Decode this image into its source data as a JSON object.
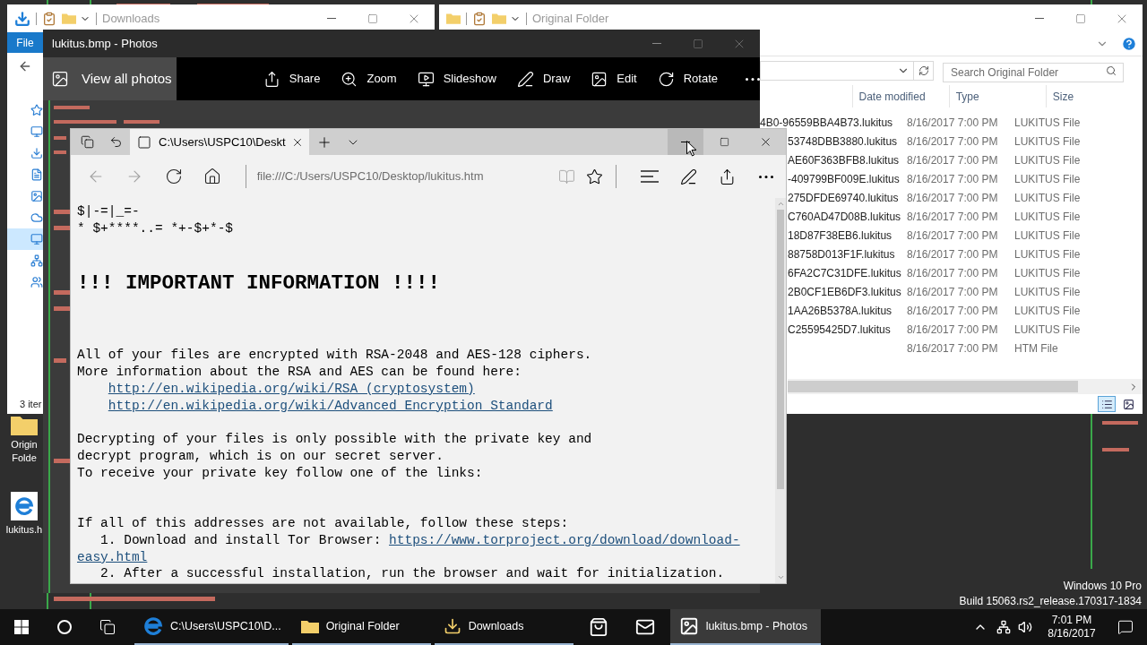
{
  "desktop": {
    "icons": [
      {
        "kind": "folder",
        "label": "Origin Folde"
      },
      {
        "kind": "browser",
        "label": "lukitus.h"
      }
    ],
    "watermark": [
      "Windows 10 Pro",
      "Build 15063.rs2_release.170317-1834"
    ]
  },
  "downloads_window": {
    "title": "Downloads",
    "ribbon_tab": "File",
    "status": "3 iter",
    "nav_items": [
      {
        "kind": "quick-access",
        "selected": false
      },
      {
        "kind": "desktop",
        "selected": false
      },
      {
        "kind": "downloads",
        "selected": false
      },
      {
        "kind": "documents",
        "selected": false
      },
      {
        "kind": "pictures",
        "selected": false
      },
      {
        "kind": "cloud",
        "selected": false
      },
      {
        "kind": "pc",
        "selected": true
      },
      {
        "kind": "network",
        "selected": false
      },
      {
        "kind": "homegroup",
        "selected": false
      }
    ]
  },
  "original_folder_window": {
    "title": "Original Folder",
    "search": {
      "placeholder": "Search Original Folder"
    },
    "columns": [
      "Date modified",
      "Type",
      "Size"
    ],
    "rows": [
      {
        "name": "4B0-96559BBA4B73.lukitus",
        "date": "8/16/2017 7:00 PM",
        "type": "LUKITUS File"
      },
      {
        "name": "53748DBB3880.lukitus",
        "date": "8/16/2017 7:00 PM",
        "type": "LUKITUS File"
      },
      {
        "name": "AE60F363BFB8.lukitus",
        "date": "8/16/2017 7:00 PM",
        "type": "LUKITUS File"
      },
      {
        "name": "-409799BF009E.lukitus",
        "date": "8/16/2017 7:00 PM",
        "type": "LUKITUS File"
      },
      {
        "name": "275DFDE69740.lukitus",
        "date": "8/16/2017 7:00 PM",
        "type": "LUKITUS File"
      },
      {
        "name": "C760AD47D08B.lukitus",
        "date": "8/16/2017 7:00 PM",
        "type": "LUKITUS File"
      },
      {
        "name": "18D87F38EB6.lukitus",
        "date": "8/16/2017 7:00 PM",
        "type": "LUKITUS File"
      },
      {
        "name": "88758D013F1F.lukitus",
        "date": "8/16/2017 7:00 PM",
        "type": "LUKITUS File"
      },
      {
        "name": "6FA2C7C31DFE.lukitus",
        "date": "8/16/2017 7:00 PM",
        "type": "LUKITUS File"
      },
      {
        "name": "2B0CF1EB6DF3.lukitus",
        "date": "8/16/2017 7:00 PM",
        "type": "LUKITUS File"
      },
      {
        "name": "1AA26B5378A.lukitus",
        "date": "8/16/2017 7:00 PM",
        "type": "LUKITUS File"
      },
      {
        "name": "C25595425D7.lukitus",
        "date": "8/16/2017 7:00 PM",
        "type": "LUKITUS File"
      },
      {
        "date": "8/16/2017 7:00 PM",
        "type": "HTM File"
      }
    ]
  },
  "photos_window": {
    "title": "lukitus.bmp - Photos",
    "view_all": "View all photos",
    "tools": [
      {
        "kind": "share",
        "label": "Share"
      },
      {
        "kind": "zoom",
        "label": "Zoom"
      },
      {
        "kind": "slideshow",
        "label": "Slideshow"
      },
      {
        "kind": "draw",
        "label": "Draw"
      },
      {
        "kind": "edit",
        "label": "Edit"
      },
      {
        "kind": "rotate",
        "label": "Rotate"
      },
      {
        "kind": "more"
      }
    ]
  },
  "browser": {
    "tab": {
      "title": "C:\\Users\\USPC10\\Deskt"
    },
    "minimize_hovered": true,
    "nav_buttons": [
      {
        "kind": "back",
        "disabled": true
      },
      {
        "kind": "forward",
        "disabled": true
      },
      {
        "kind": "refresh",
        "disabled": false
      },
      {
        "kind": "home",
        "disabled": false
      }
    ],
    "address": "file:///C:/Users/USPC10/Desktop/lukitus.htm",
    "reading_view_disabled": true,
    "content": [
      {
        "kind": "ascii",
        "lines": [
          "$|-=|_=-",
          "* $+****..= *+-$+*-$"
        ]
      },
      {
        "kind": "heading",
        "text": "!!! IMPORTANT INFORMATION !!!!"
      },
      {
        "kind": "paragraph",
        "lines": [
          {
            "kind": "text",
            "text": "All of your files are encrypted with RSA-2048 and AES-128 ciphers."
          },
          {
            "kind": "text",
            "text": "More information about the RSA and AES can be found here:"
          },
          {
            "kind": "link",
            "text": "http://en.wikipedia.org/wiki/RSA_(cryptosystem)"
          },
          {
            "kind": "link",
            "text": "http://en.wikipedia.org/wiki/Advanced_Encryption_Standard"
          }
        ]
      },
      {
        "kind": "paragraph",
        "lines": [
          {
            "kind": "text",
            "text": "Decrypting of your files is only possible with the private key and"
          },
          {
            "kind": "text",
            "text": "decrypt program, which is on our secret server."
          },
          {
            "kind": "text",
            "text": "To receive your private key follow one of the links:"
          }
        ]
      },
      {
        "kind": "paragraph",
        "lines": [
          {
            "kind": "text",
            "text": "If all of this addresses are not available, follow these steps:"
          },
          {
            "kind": "step",
            "text": "1. Download and install Tor Browser:",
            "link": "https://www.torproject.org/download/download-"
          },
          {
            "kind": "link_continued",
            "text": "easy.html"
          },
          {
            "kind": "step",
            "text": "2. After a successful installation, run the browser and wait for initialization."
          }
        ]
      }
    ]
  },
  "taskbar": {
    "apps": [
      {
        "kind": "browser",
        "label": "C:\\Users\\USPC10\\D...",
        "selected": false
      },
      {
        "kind": "folder",
        "label": "Original Folder",
        "selected": false
      },
      {
        "kind": "downloads",
        "label": "Downloads",
        "selected": false
      },
      {
        "kind": "store"
      },
      {
        "kind": "mail"
      },
      {
        "kind": "photos",
        "label": "lukitus.bmp - Photos",
        "selected": true
      }
    ],
    "time": "7:01 PM",
    "date": "8/16/2017"
  }
}
